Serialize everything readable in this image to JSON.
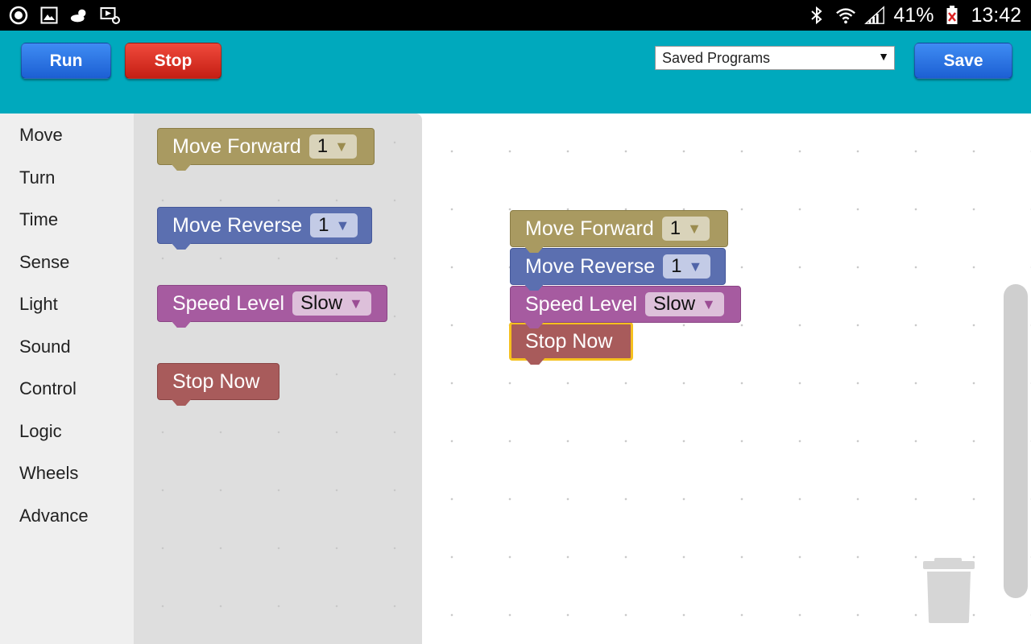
{
  "status_bar": {
    "battery": "41%",
    "time": "13:42",
    "left_icons": [
      "circle-app-icon",
      "gallery-icon",
      "weather-icon",
      "screen-mirror-icon"
    ],
    "right_icons": [
      "bluetooth-icon",
      "wifi-icon",
      "signal-icon",
      "battery-icon"
    ]
  },
  "toolbar": {
    "run_label": "Run",
    "stop_label": "Stop",
    "save_label": "Save",
    "saved_programs": "Saved Programs"
  },
  "categories": [
    "Move",
    "Turn",
    "Time",
    "Sense",
    "Light",
    "Sound",
    "Control",
    "Logic",
    "Wheels",
    "Advance"
  ],
  "flyout": {
    "move_forward": {
      "label": "Move Forward",
      "value": "1"
    },
    "move_reverse": {
      "label": "Move Reverse",
      "value": "1"
    },
    "speed_level": {
      "label": "Speed Level",
      "value": "Slow"
    },
    "stop_now": {
      "label": "Stop Now"
    }
  },
  "workspace": {
    "move_forward": {
      "label": "Move Forward",
      "value": "1"
    },
    "move_reverse": {
      "label": "Move Reverse",
      "value": "1"
    },
    "speed_level": {
      "label": "Speed Level",
      "value": "Slow"
    },
    "stop_now": {
      "label": "Stop Now"
    }
  },
  "dropdown_arrow": "▼",
  "colors": {
    "toolbar": "#00a9bd",
    "run_button": "#2b74e6",
    "stop_button": "#e0352a",
    "move_forward_block": "#a99a61",
    "move_reverse_block": "#5b6fb0",
    "speed_level_block": "#a65ba0",
    "stop_now_block": "#a85b5b",
    "selection_highlight": "#f5c01e"
  }
}
